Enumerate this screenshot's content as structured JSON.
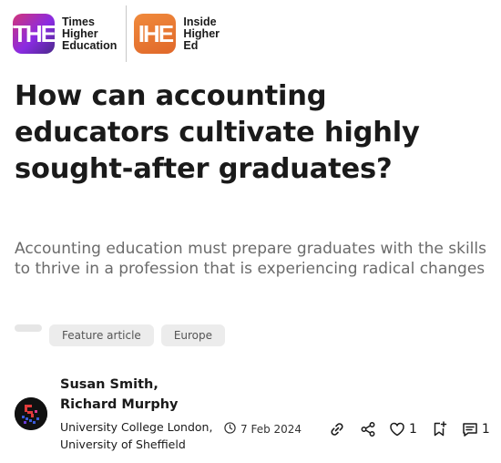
{
  "logos": {
    "the": {
      "mark": "THE",
      "name": "Times\nHigher\nEducation"
    },
    "ihe": {
      "mark": "IHE",
      "name": "Inside\nHigher\nEd"
    }
  },
  "article": {
    "title": "How can accounting educators cultivate highly sought-after graduates?",
    "subtitle": "Accounting education must prepare graduates with the skills to thrive in a profession that is experiencing radical changes",
    "tags": [
      "Feature article",
      "Europe"
    ]
  },
  "byline": {
    "authors": [
      "Susan Smith,",
      "Richard Murphy"
    ],
    "affiliations": [
      "University College London,",
      "University of Sheffield"
    ],
    "date": "7 Feb 2024"
  },
  "actions": {
    "likes": "1",
    "comments": "1"
  },
  "icons": [
    "clock-icon",
    "link-icon",
    "share-icon",
    "heart-icon",
    "bookmark-add-icon",
    "comment-icon"
  ]
}
